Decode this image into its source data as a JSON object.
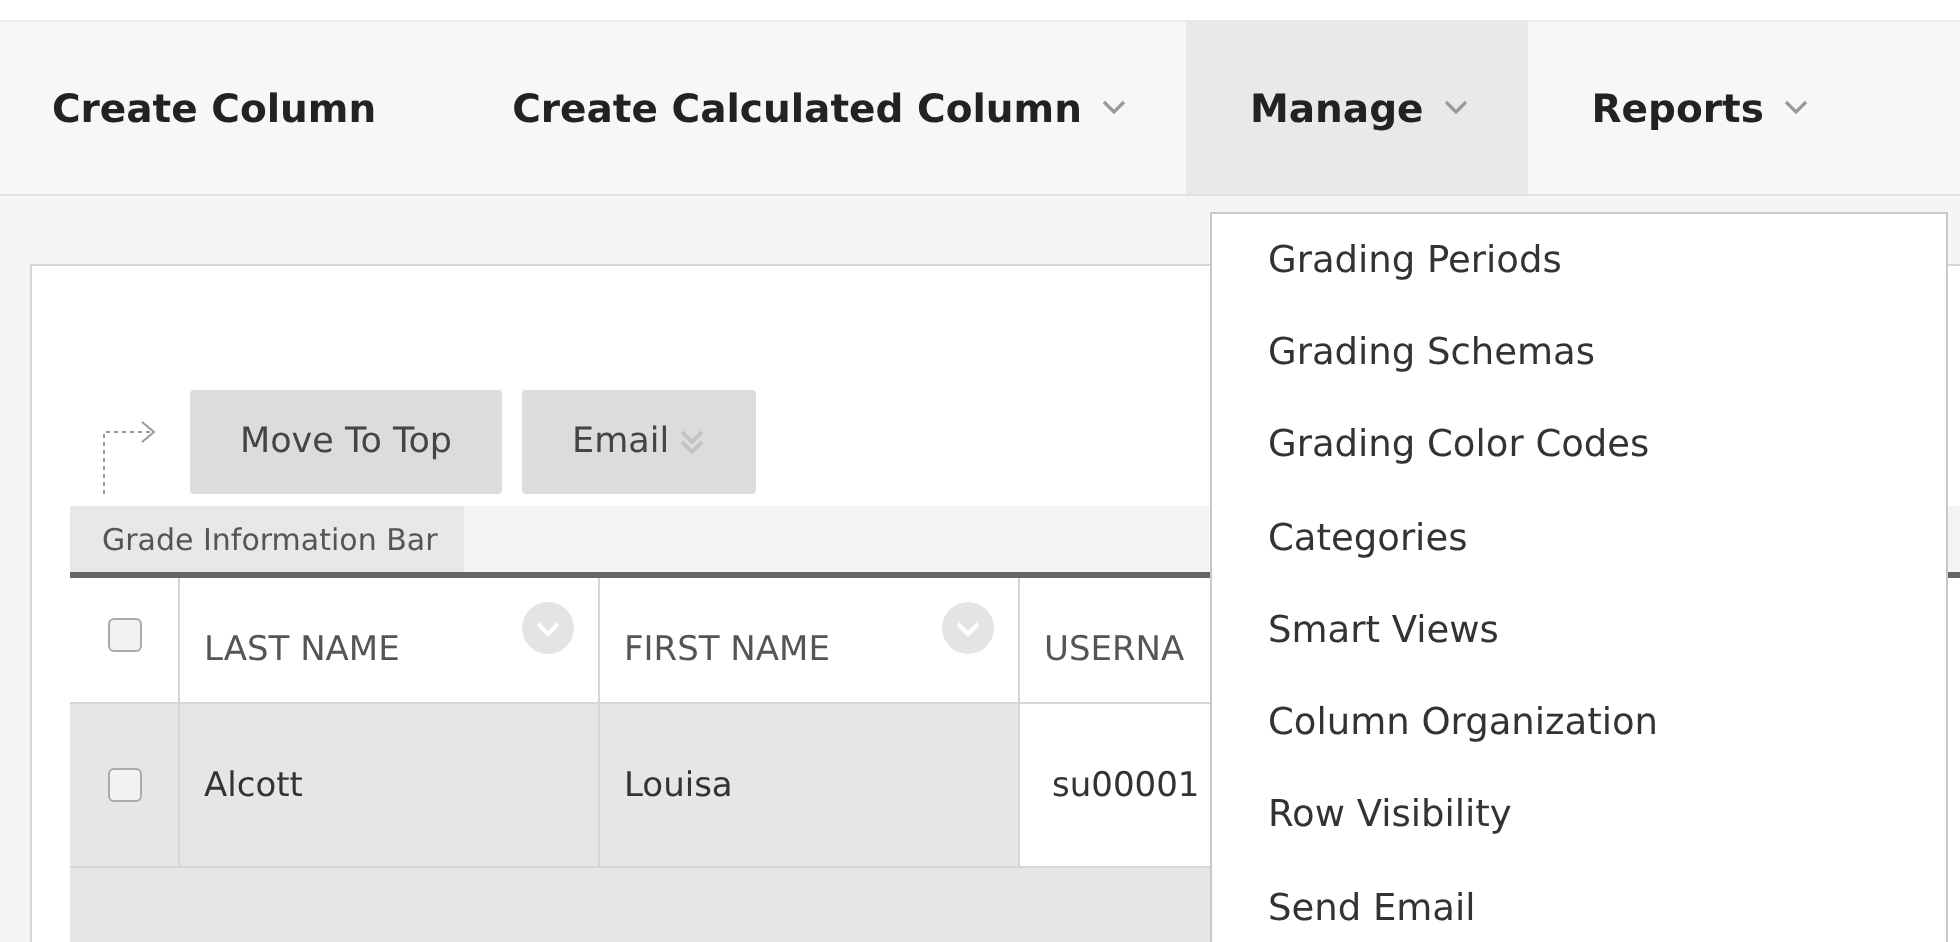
{
  "toolbar": {
    "items": [
      {
        "label": "Create Column",
        "has_menu": false,
        "selected": false
      },
      {
        "label": "Create Calculated Column",
        "has_menu": true,
        "selected": false
      },
      {
        "label": "Manage",
        "has_menu": true,
        "selected": true
      },
      {
        "label": "Reports",
        "has_menu": true,
        "selected": false
      }
    ]
  },
  "menu": {
    "items": [
      "Grading Periods",
      "Grading Schemas",
      "Grading Color Codes",
      "Categories",
      "Smart Views",
      "Column Organization",
      "Row Visibility",
      "Send Email"
    ]
  },
  "action_buttons": [
    {
      "label": "Move To Top",
      "has_menu": false
    },
    {
      "label": "Email",
      "has_menu": true
    }
  ],
  "info_bar": {
    "label": "Grade Information Bar"
  },
  "table": {
    "select_all_checked": false,
    "columns": [
      {
        "label": "LAST NAME",
        "has_menu": true
      },
      {
        "label": "FIRST NAME",
        "has_menu": true
      },
      {
        "label": "USERNA",
        "has_menu": false
      }
    ],
    "rows": [
      {
        "checked": false,
        "cells": [
          "Alcott",
          "Louisa",
          "su00001"
        ]
      }
    ]
  }
}
